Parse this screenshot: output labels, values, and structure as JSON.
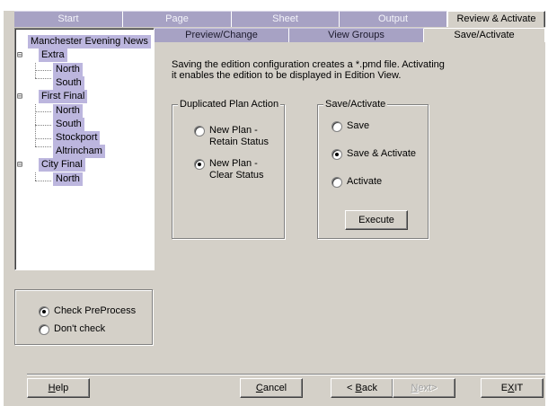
{
  "top_tabs": [
    {
      "label": "Start"
    },
    {
      "label": "Page"
    },
    {
      "label": "Sheet"
    },
    {
      "label": "Output"
    },
    {
      "label": "Review & Activate"
    }
  ],
  "sub_tabs": [
    {
      "label": "Preview/Change"
    },
    {
      "label": "View Groups"
    },
    {
      "label": "Save/Activate"
    }
  ],
  "tree": {
    "root": "Manchester Evening News",
    "editions": [
      {
        "label": "Extra",
        "expander": "⊟",
        "children": [
          "North",
          "South"
        ]
      },
      {
        "label": "First Final",
        "expander": "⊟",
        "children": [
          "North",
          "South",
          "Stockport",
          "Altrincham"
        ]
      },
      {
        "label": "City Final",
        "expander": "⊟",
        "children": [
          "North"
        ]
      }
    ]
  },
  "description": "Saving the edition configuration creates a *.pmd file. Activating it enables the edition to be displayed in Edition View.",
  "duplicated_plan": {
    "legend": "Duplicated Plan Action",
    "options": [
      {
        "label_line1": "New Plan -",
        "label_line2": "Retain Status",
        "checked": false
      },
      {
        "label_line1": "New Plan -",
        "label_line2": "Clear Status",
        "checked": true
      }
    ]
  },
  "save_activate": {
    "legend": "Save/Activate",
    "options": [
      {
        "label": "Save",
        "checked": false
      },
      {
        "label": "Save & Activate",
        "checked": true
      },
      {
        "label": "Activate",
        "checked": false
      }
    ],
    "execute_label": "Execute"
  },
  "preprocess": {
    "options": [
      {
        "label": "Check PreProcess",
        "checked": true
      },
      {
        "label": "Don't check",
        "checked": false
      }
    ]
  },
  "buttons": {
    "help": {
      "mnemonic": "H",
      "rest": "elp"
    },
    "cancel": {
      "mnemonic": "C",
      "rest": "ancel"
    },
    "back": {
      "prefix": "< ",
      "mnemonic": "B",
      "rest": "ack"
    },
    "next": {
      "mnemonic": "N",
      "rest": "ext>",
      "disabled": true
    },
    "exit": {
      "prefix": "E",
      "mnemonic": "X",
      "rest": "IT"
    }
  },
  "colors": {
    "tab_inactive": "#a7a2c4",
    "selection": "#bcb6de",
    "face": "#d4d0c8"
  }
}
